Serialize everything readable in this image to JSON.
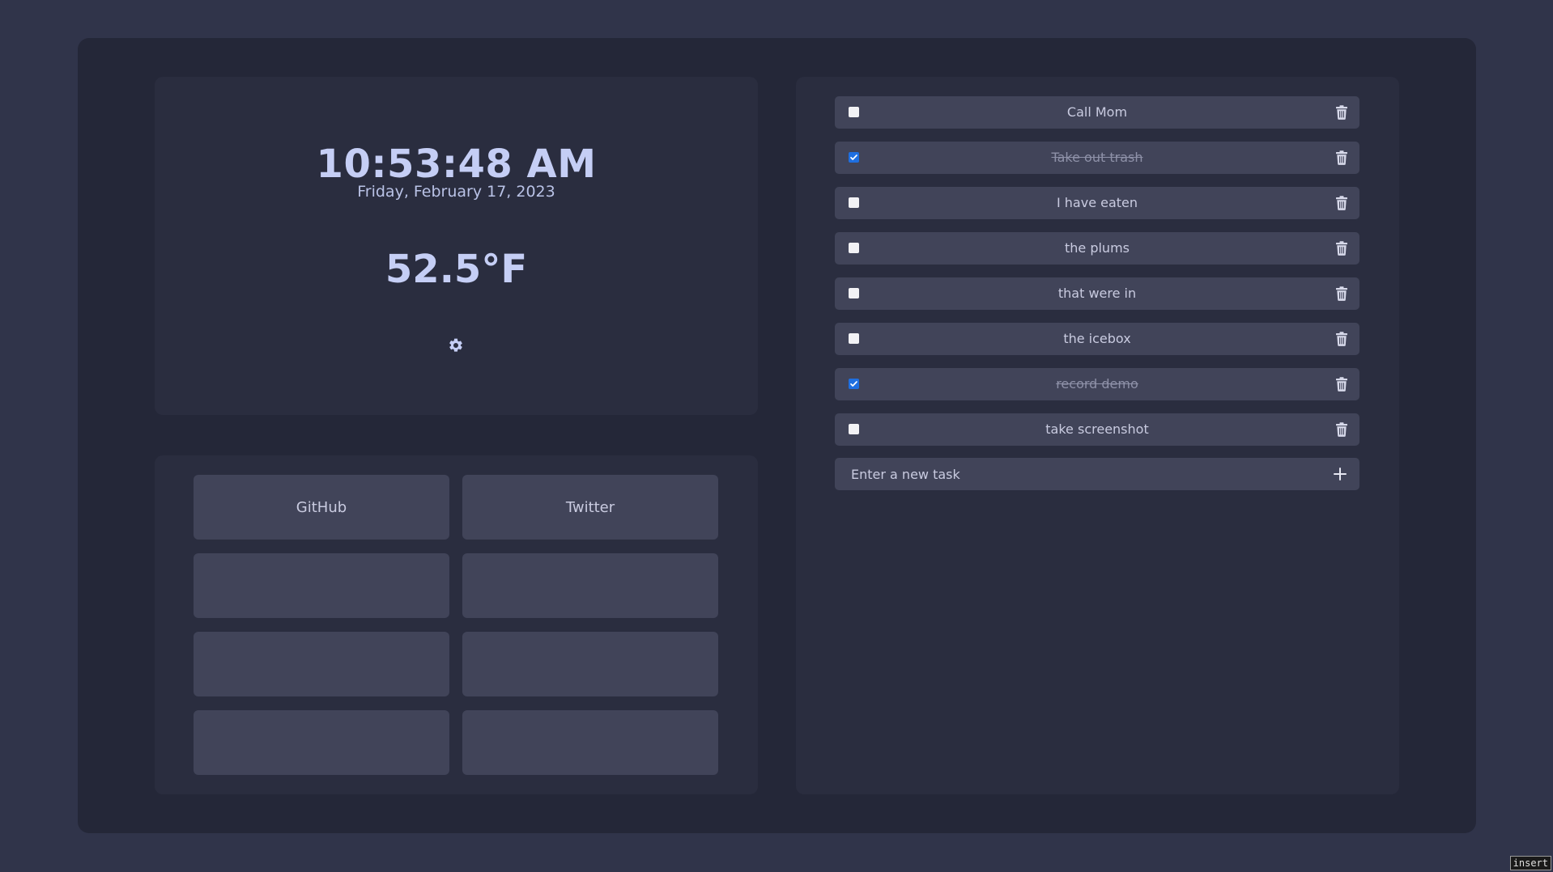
{
  "clock": {
    "time": "10:53:48 AM",
    "date": "Friday, February 17, 2023",
    "temperature": "52.5°F",
    "settings_icon": "gear-icon"
  },
  "links": [
    {
      "label": "GitHub"
    },
    {
      "label": "Twitter"
    },
    {
      "label": ""
    },
    {
      "label": ""
    },
    {
      "label": ""
    },
    {
      "label": ""
    },
    {
      "label": ""
    },
    {
      "label": ""
    }
  ],
  "todos": [
    {
      "label": "Call Mom",
      "done": false
    },
    {
      "label": "Take out trash",
      "done": true
    },
    {
      "label": "I have eaten",
      "done": false
    },
    {
      "label": "the plums",
      "done": false
    },
    {
      "label": "that were in",
      "done": false
    },
    {
      "label": "the icebox",
      "done": false
    },
    {
      "label": "record demo",
      "done": true
    },
    {
      "label": "take screenshot",
      "done": false
    }
  ],
  "new_task": {
    "placeholder": "Enter a new task",
    "value": ""
  },
  "mode_indicator": "insert",
  "colors": {
    "background": "#30344a",
    "frame": "#242738",
    "panel": "#2a2d3f",
    "tile": "#414459",
    "accent": "#1f6fe0"
  }
}
